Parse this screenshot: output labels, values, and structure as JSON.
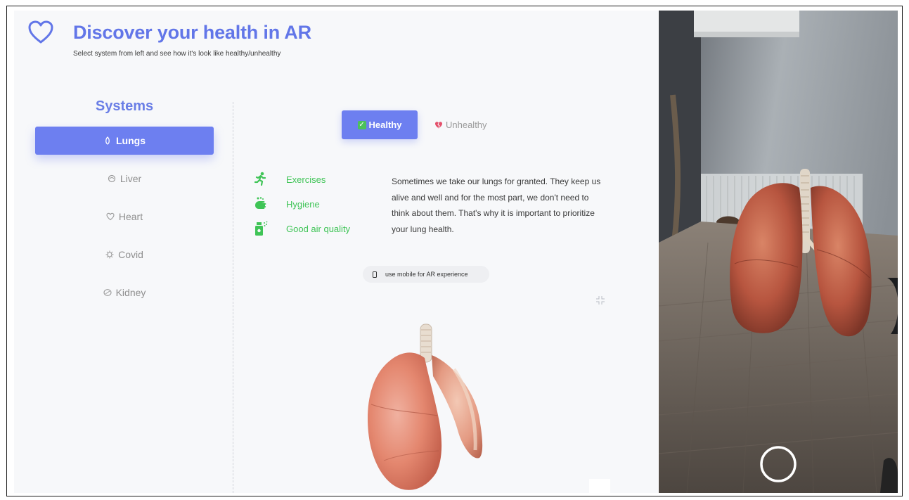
{
  "header": {
    "title": "Discover your health in AR",
    "subtitle": "Select system from left and see how it's look like healthy/unhealthy",
    "logo_icon": "heart-outline-icon"
  },
  "sidebar": {
    "heading": "Systems",
    "items": [
      {
        "label": "Lungs",
        "icon": "lungs-icon",
        "active": true
      },
      {
        "label": "Liver",
        "icon": "liver-icon",
        "active": false
      },
      {
        "label": "Heart",
        "icon": "heart-icon",
        "active": false
      },
      {
        "label": "Covid",
        "icon": "virus-icon",
        "active": false
      },
      {
        "label": "Kidney",
        "icon": "kidney-icon",
        "active": false
      }
    ]
  },
  "tabs": {
    "healthy": "Healthy",
    "unhealthy": "Unhealthy",
    "selected": "Healthy"
  },
  "tips": [
    {
      "label": "Exercises",
      "icon": "running-icon"
    },
    {
      "label": "Hygiene",
      "icon": "washing-hands-icon"
    },
    {
      "label": "Good air quality",
      "icon": "air-freshener-icon"
    }
  ],
  "description": "Sometimes we take our lungs for granted. They keep us alive and well and for the most part, we don't need to think about them. That's why it is important to prioritize your lung health.",
  "ar_hint": {
    "label": "use mobile for AR experience",
    "icon": "phone-icon"
  },
  "colors": {
    "accent": "#6d7ff0",
    "tip_green": "#3fc456",
    "background": "#f7f8fa",
    "muted": "#8f8f8f"
  }
}
